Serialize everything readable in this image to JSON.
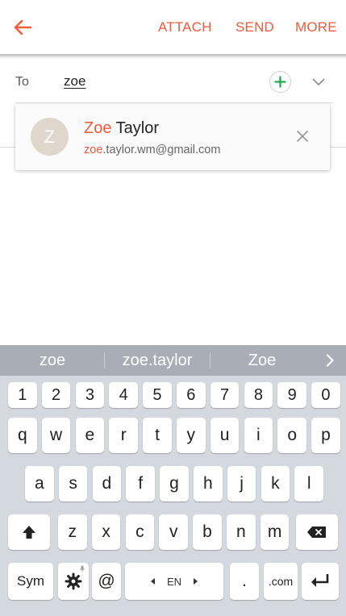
{
  "toolbar": {
    "back_icon": "arrow-left-icon",
    "actions": [
      "ATTACH",
      "SEND",
      "MORE"
    ],
    "accent_color": "#ef5a3a"
  },
  "recipient": {
    "label": "To",
    "value": "zoe"
  },
  "suggestion": {
    "avatar_initial": "Z",
    "name_match": "Zoe",
    "name_rest": " Taylor",
    "email_match": "zoe",
    "email_rest": ".taylor.wm@gmail.com"
  },
  "keyboard": {
    "predictions": [
      "zoe",
      "zoe.taylor",
      "Zoe"
    ],
    "number_row": [
      "1",
      "2",
      "3",
      "4",
      "5",
      "6",
      "7",
      "8",
      "9",
      "0"
    ],
    "row1": [
      "q",
      "w",
      "e",
      "r",
      "t",
      "y",
      "u",
      "i",
      "o",
      "p"
    ],
    "row2": [
      "a",
      "s",
      "d",
      "f",
      "g",
      "h",
      "j",
      "k",
      "l"
    ],
    "row3": [
      "z",
      "x",
      "c",
      "v",
      "b",
      "n",
      "m"
    ],
    "sym_label": "Sym",
    "at_label": "@",
    "language_label": "EN",
    "period_label": ".",
    "com_label": ".com"
  }
}
